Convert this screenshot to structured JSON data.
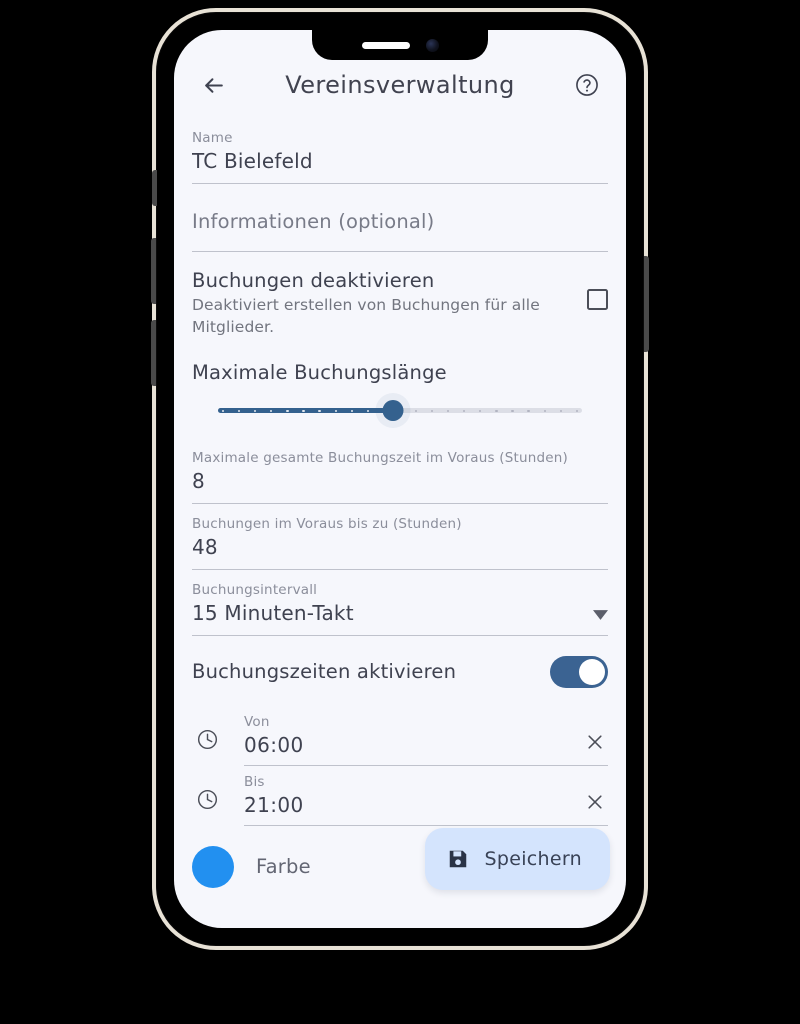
{
  "app_bar": {
    "back_icon": "arrow-left-icon",
    "title": "Vereinsverwaltung",
    "help_icon": "help-circle-icon"
  },
  "form": {
    "name_field": {
      "label": "Name",
      "value": "TC Bielefeld"
    },
    "information_field": {
      "placeholder": "Informationen (optional)",
      "value": ""
    },
    "deactivate_bookings": {
      "title": "Buchungen deaktivieren",
      "description": "Deaktiviert erstellen von Buchungen für alle Mitglieder.",
      "checked": false
    },
    "max_booking_length": {
      "title": "Maximale Buchungslänge",
      "percent": 48,
      "tick_count": 23
    },
    "max_total_time": {
      "label": "Maximale gesamte Buchungszeit im Voraus (Stunden)",
      "value": "8"
    },
    "advance_booking": {
      "label": "Buchungen im Voraus bis zu (Stunden)",
      "value": "48"
    },
    "booking_interval": {
      "label": "Buchungsintervall",
      "value": "15 Minuten-Takt",
      "caret_icon": "chevron-down-icon"
    },
    "booking_times": {
      "label": "Buchungszeiten aktivieren",
      "enabled": true
    },
    "time_from": {
      "icon": "clock-icon",
      "label": "Von",
      "value": "06:00",
      "clear_icon": "close-icon"
    },
    "time_to": {
      "icon": "clock-icon",
      "label": "Bis",
      "value": "21:00",
      "clear_icon": "close-icon"
    },
    "color": {
      "label": "Farbe",
      "swatch_color": "#2290f0"
    }
  },
  "save_button": {
    "label": "Speichern",
    "icon": "save-floppy-icon",
    "background": "#d4e4fd"
  },
  "theme": {
    "accent": "#34618e",
    "screen_background": "#f6f7fc",
    "divider": "#bfc2cc",
    "text_primary": "#3f4250",
    "text_secondary": "#8b8e9b"
  },
  "device": {
    "notch_speaker": "speaker-grille",
    "notch_camera": "front-camera",
    "buttons": [
      "silent-switch",
      "volume-up",
      "volume-down",
      "power"
    ]
  }
}
